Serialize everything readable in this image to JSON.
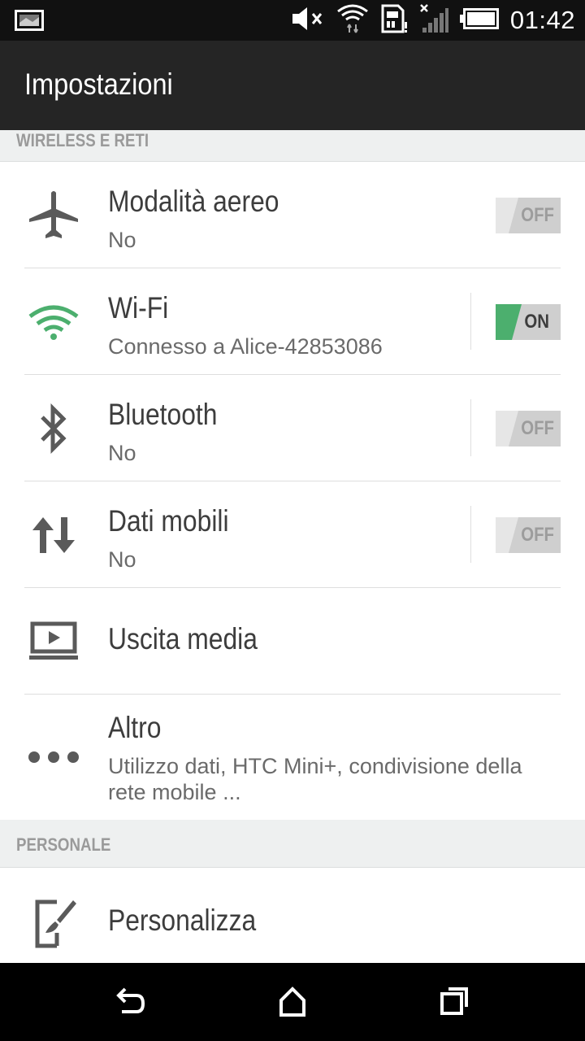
{
  "status_bar": {
    "time": "01:42",
    "icons": [
      "notification-image-icon",
      "volume-muted-icon",
      "wifi-icon",
      "sim-alert-icon",
      "signal-off-icon",
      "battery-icon"
    ]
  },
  "app_bar": {
    "title": "Impostazioni"
  },
  "sections": [
    {
      "header": "WIRELESS E RETI",
      "items": [
        {
          "label": "Modalità aereo",
          "subtitle": "No",
          "icon": "airplane-icon",
          "toggle": "OFF"
        },
        {
          "label": "Wi-Fi",
          "subtitle": "Connesso a Alice-42853086",
          "icon": "wifi-icon",
          "toggle": "ON"
        },
        {
          "label": "Bluetooth",
          "subtitle": "No",
          "icon": "bluetooth-icon",
          "toggle": "OFF"
        },
        {
          "label": "Dati mobili",
          "subtitle": "No",
          "icon": "mobile-data-icon",
          "toggle": "OFF"
        },
        {
          "label": "Uscita media",
          "icon": "media-output-icon"
        },
        {
          "label": "Altro",
          "subtitle": "Utilizzo dati, HTC Mini+, condivisione della rete mobile ...",
          "icon": "more-dots-icon"
        }
      ]
    },
    {
      "header": "PERSONALE",
      "items": [
        {
          "label": "Personalizza",
          "icon": "personalize-icon"
        }
      ]
    }
  ],
  "nav_bar": {
    "icons": [
      "back-icon",
      "home-icon",
      "recents-icon"
    ]
  },
  "colors": {
    "accent": "#4caf6e",
    "toggle_bg": "#cfcfcf",
    "header_bg": "#252525"
  }
}
